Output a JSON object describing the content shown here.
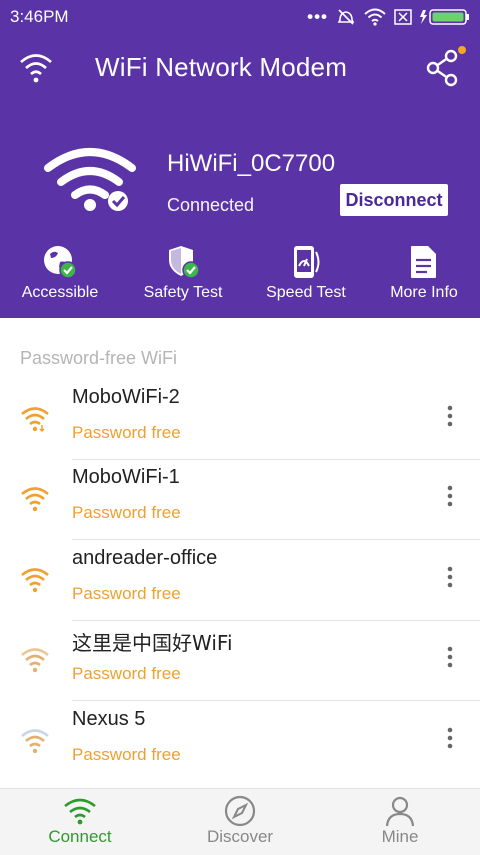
{
  "status_bar": {
    "time": "3:46PM",
    "icons": [
      "dots-icon",
      "mute-icon",
      "wifi-icon",
      "sim-icon",
      "battery-icon"
    ]
  },
  "header": {
    "title": "WiFi Network Modem",
    "ssid": "HiWiFi_0C7700",
    "status": "Connected",
    "disconnect_label": "Disconnect",
    "actions": [
      {
        "label": "Accessible",
        "icon": "globe-check-icon"
      },
      {
        "label": "Safety Test",
        "icon": "shield-check-icon"
      },
      {
        "label": "Speed Test",
        "icon": "phone-speed-icon"
      },
      {
        "label": "More Info",
        "icon": "document-icon"
      }
    ]
  },
  "list": {
    "section_label": "Password-free WiFi",
    "items": [
      {
        "name": "MoboWiFi-2",
        "status": "Password free"
      },
      {
        "name": "MoboWiFi-1",
        "status": "Password free"
      },
      {
        "name": "andreader-office",
        "status": "Password free"
      },
      {
        "name": "这里是中国好WiFi",
        "status": "Password free"
      },
      {
        "name": "Nexus 5",
        "status": "Password free"
      }
    ]
  },
  "bottom_nav": [
    {
      "label": "Connect",
      "icon": "wifi-icon",
      "active": true
    },
    {
      "label": "Discover",
      "icon": "compass-icon",
      "active": false
    },
    {
      "label": "Mine",
      "icon": "person-icon",
      "active": false
    }
  ],
  "colors": {
    "brand_purple": "#5a33a7",
    "password_free": "#f0a030",
    "active_nav": "#2e9a2e"
  }
}
